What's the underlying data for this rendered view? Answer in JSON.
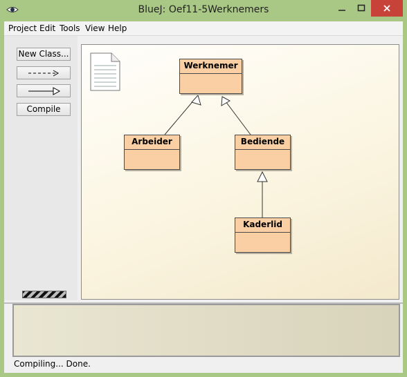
{
  "window": {
    "title": "BlueJ:  Oef11-5Werknemers",
    "colors": {
      "titlebar": "#a9c785",
      "close_button": "#c7433a"
    }
  },
  "menu": [
    "Project",
    "Edit",
    "Tools",
    "View",
    "Help"
  ],
  "toolbar": {
    "new_class_label": "New Class...",
    "uses_arrow_icon": "dashed-arrow-icon",
    "inherits_arrow_icon": "solid-arrow-icon",
    "compile_label": "Compile"
  },
  "diagram": {
    "note_icon": "readme-document-icon",
    "classes": [
      {
        "id": "werknemer",
        "name": "Werknemer"
      },
      {
        "id": "arbeider",
        "name": "Arbeider",
        "extends": "Werknemer"
      },
      {
        "id": "bediende",
        "name": "Bediende",
        "extends": "Werknemer"
      },
      {
        "id": "kaderlid",
        "name": "Kaderlid",
        "extends": "Bediende"
      }
    ],
    "class_color": "#f9cfa3"
  },
  "status": {
    "text": "Compiling... Done."
  }
}
